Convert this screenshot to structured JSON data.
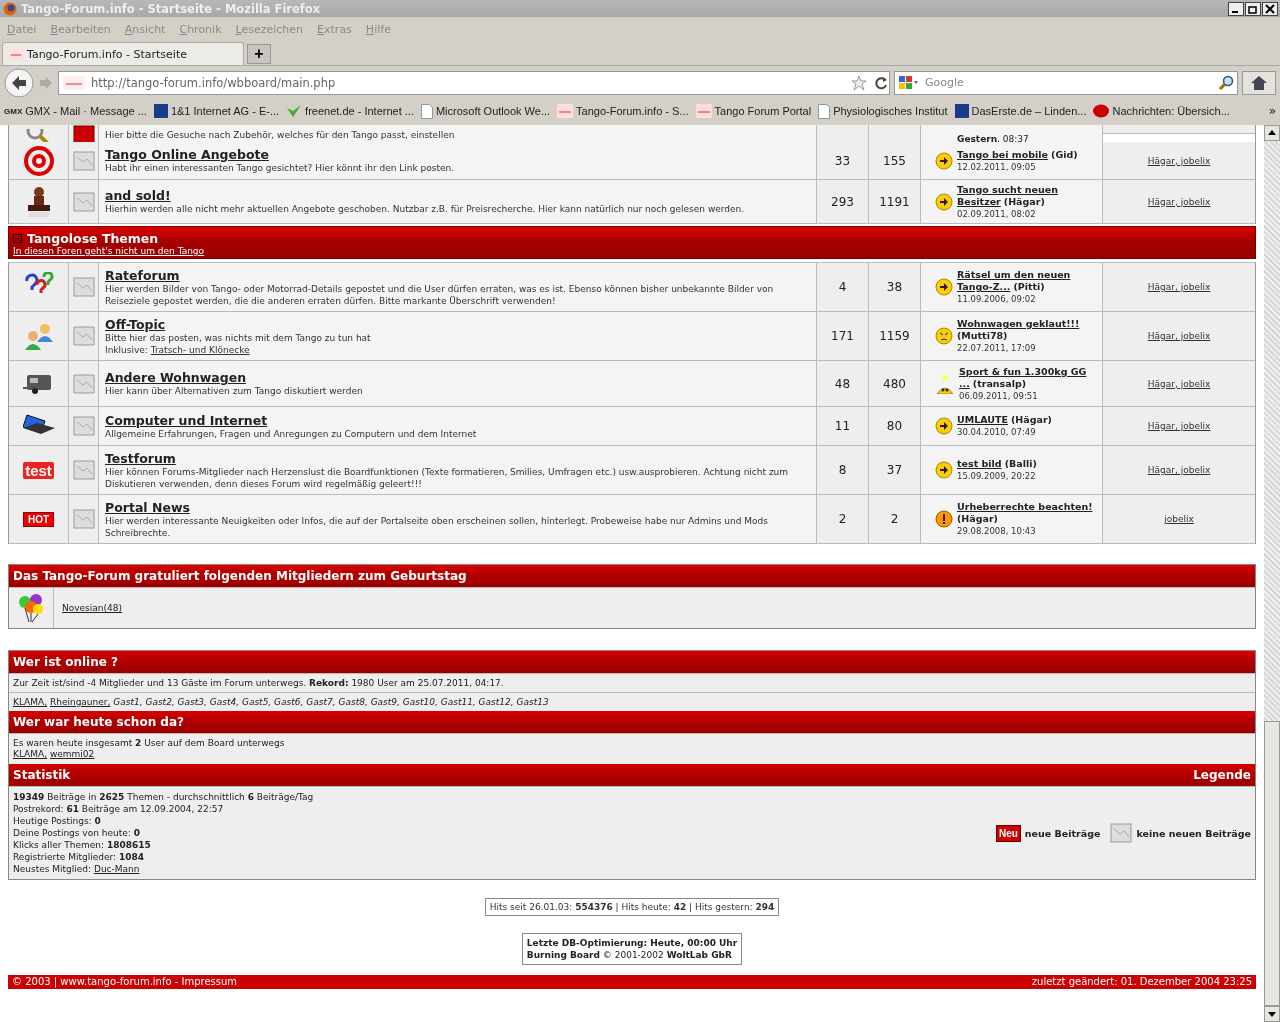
{
  "window": {
    "title": "Tango-Forum.info - Startseite - Mozilla Firefox"
  },
  "menu": [
    "Datei",
    "Bearbeiten",
    "Ansicht",
    "Chronik",
    "Lesezeichen",
    "Extras",
    "Hilfe"
  ],
  "tab": {
    "title": "Tango-Forum.info - Startseite",
    "new_tab": "+"
  },
  "address": {
    "url": "http://tango-forum.info/wbboard/main.php",
    "search_placeholder": "Google"
  },
  "bookmarks": [
    {
      "label": "GMX - Mail · Message ...",
      "kind": "gmx",
      "badge": "GMX"
    },
    {
      "label": "1&1 Internet AG - E-...",
      "kind": "square"
    },
    {
      "label": "freenet.de - Internet ...",
      "kind": "check"
    },
    {
      "label": "Microsoft Outlook We...",
      "kind": "page"
    },
    {
      "label": "Tango-Forum.info - S...",
      "kind": "tango"
    },
    {
      "label": "Tango Forum Portal",
      "kind": "tango"
    },
    {
      "label": "Physiologisches Institut",
      "kind": "page"
    },
    {
      "label": "DasErste.de – Linden...",
      "kind": "square"
    },
    {
      "label": "Nachrichten: Übersich...",
      "kind": "dot"
    }
  ],
  "bookmarks_more": "»",
  "cut_row": {
    "new": true,
    "description": "Hier bitte die Gesuche nach Zubehör, welches für den Tango passt, einstellen",
    "last_date": "**Gestern**, 08:37"
  },
  "forums_top": [
    {
      "kind": "at",
      "new": false,
      "title": "Tango Online Angebote",
      "description": "Habt ihr einen interessanten Tango gesichtet? Hier könnt ihr den Link posten.",
      "threads": "33",
      "posts": "155",
      "last_post": {
        "kind": "arrow",
        "title": "Tango bei mobile",
        "author": "(Gid)",
        "date": "12.02.2011, 09:05"
      },
      "moderators": "Hägar, jobelix"
    },
    {
      "kind": "sold",
      "new": false,
      "title": "and sold!",
      "description": "Hierhin werden alle nicht mehr aktuellen Angebote geschoben. Nutzbar z.B. für Preisrecherche. Hier kann natürlich nur noch gelesen werden.",
      "threads": "293",
      "posts": "1191",
      "last_post": {
        "kind": "arrow",
        "title": "Tango sucht neuen Besitzer",
        "author": "(Hägar)",
        "date": "02.09.2011, 08:02"
      },
      "moderators": "Hägar, jobelix"
    }
  ],
  "category": {
    "title": "Tangolose Themen",
    "subtitle": "In diesen Foren geht's nicht um den Tango",
    "expanded": true
  },
  "forums": [
    {
      "kind": "question",
      "new": false,
      "title": "Rateforum",
      "description": "Hier werden Bilder von Tango- oder Motorrad-Details gepostet und die User dürfen erraten, was es ist. Ebenso können bisher unbekannte Bilder von Reiseziele gepostet werden, die die anderen erraten dürfen. Bitte markante Überschrift verwenden!",
      "threads": "4",
      "posts": "38",
      "last_post": {
        "kind": "arrow",
        "title": "Rätsel um den neuen Tango-Z...",
        "author": "(Pitti)",
        "date": "11.09.2006, 09:02"
      },
      "moderators": "Hägar, jobelix"
    },
    {
      "kind": "people",
      "new": false,
      "title": "Off-Topic",
      "description": "Bitte hier das posten, was nichts mit dem Tango zu tun hat",
      "sub_prefix": "Inklusive:",
      "sub_link": "Tratsch- und Klönecke",
      "threads": "171",
      "posts": "1159",
      "last_post": {
        "kind": "angry",
        "title": "Wohnwagen geklaut!!!",
        "author": "(Mutti78)",
        "date": "22.07.2011, 17:09"
      },
      "moderators": "Hägar, jobelix"
    },
    {
      "kind": "caravan",
      "new": false,
      "title": "Andere Wohnwagen",
      "description": "Hier kann über Alternativen zum Tango diskutiert werden",
      "threads": "48",
      "posts": "480",
      "last_post": {
        "kind": "idea",
        "title": "Sport & fun 1.300kg GG ...",
        "author": "(transalp)",
        "date": "06.09.2011, 09:51"
      },
      "moderators": "Hägar, jobelix"
    },
    {
      "kind": "laptop",
      "new": false,
      "title": "Computer und Internet",
      "description": "Allgemeine Erfahrungen, Fragen und Anregungen zu Computern und dem Internet",
      "threads": "11",
      "posts": "80",
      "last_post": {
        "kind": "arrow",
        "title": "UMLAUTE",
        "author": "(Hägar)",
        "date": "30.04.2010, 07:49"
      },
      "moderators": "Hägar, jobelix"
    },
    {
      "kind": "test",
      "badge": "test",
      "new": false,
      "title": "Testforum",
      "description": "Hier können Forums-Mitglieder nach Herzenslust die Boardfunktionen (Texte formatieren, Smilies, Umfragen etc.) usw.ausprobieren. Achtung nicht zum Diskutieren verwenden, denn dieses Forum wird regelmäßig geleert!!!",
      "threads": "8",
      "posts": "37",
      "last_post": {
        "kind": "arrow",
        "title": "test bild",
        "author": "(Balli)",
        "date": "15.09.2009, 20:22"
      },
      "moderators": "Hägar, jobelix"
    },
    {
      "kind": "hot",
      "badge": "HOT",
      "new": false,
      "title": "Portal News",
      "description": "Hier werden interessante Neuigkeiten oder Infos, die auf der Portalseite oben erscheinen sollen, hinterlegt. Probeweise habe nur Admins und Mods Schreibrechte.",
      "threads": "2",
      "posts": "2",
      "last_post": {
        "kind": "warning",
        "title": "Urheberrechte beachten!",
        "author": "(Hägar)",
        "date": "29.08.2008, 10:43"
      },
      "moderators": "jobelix"
    }
  ],
  "birthday": {
    "title": "Das Tango-Forum gratuliert folgenden Mitgliedern zum Geburtstag",
    "members": [
      "Novesian(48)"
    ]
  },
  "online": {
    "title": "Wer ist online ?",
    "text": "Zur Zeit ist/sind -4 Mitglieder und 13 Gäste im Forum unterwegs. **Rekord:** 1980 User am 25.07.2011, 04:17.",
    "users": [
      {
        "name": "KLAMA,",
        "kind": "member"
      },
      {
        "name": "Rheingauner,",
        "kind": "member"
      },
      {
        "name": "Gast1,",
        "kind": "guest"
      },
      {
        "name": "Gast2,",
        "kind": "guest"
      },
      {
        "name": "Gast3,",
        "kind": "guest"
      },
      {
        "name": "Gast4,",
        "kind": "guest"
      },
      {
        "name": "Gast5,",
        "kind": "guest"
      },
      {
        "name": "Gast6,",
        "kind": "guest"
      },
      {
        "name": "Gast7,",
        "kind": "guest"
      },
      {
        "name": "Gast8,",
        "kind": "guest"
      },
      {
        "name": "Gast9,",
        "kind": "guest"
      },
      {
        "name": "Gast10,",
        "kind": "guest"
      },
      {
        "name": "Gast11,",
        "kind": "guest"
      },
      {
        "name": "Gast12,",
        "kind": "guest"
      },
      {
        "name": "Gast13",
        "kind": "guest"
      }
    ]
  },
  "today": {
    "title": "Wer war heute schon da?",
    "text": "Es waren heute insgesamt **2** User auf dem Board unterwegs",
    "users": [
      "KLAMA,",
      "wemmi02"
    ]
  },
  "stats": {
    "title": "Statistik",
    "legend_title": "Legende",
    "lines": [
      "**19349** Beiträge in **2625** Themen - durchschnittlich **6** Beiträge/Tag",
      "Postrekord: **61** Beiträge am 12.09.2004, 22:57",
      "Heutige Postings: **0**",
      "Deine Postings von heute: **0**",
      "Klicks aller Themen: **1808615**",
      "Registrierte Mitglieder: **1084**"
    ],
    "newest_label": "Neustes Mitglied:",
    "newest_member": "Duc-Mann",
    "legend": [
      {
        "kind": "new",
        "badge": "Neu",
        "label": "neue Beiträge"
      },
      {
        "kind": "old",
        "label": "keine neuen Beiträge"
      }
    ]
  },
  "hits": "Hits seit 26.01.03: **554376** | Hits heute: **42** | Hits gestern: **294**",
  "db": [
    "**Letzte DB-Optimierung: Heute, 00:00 Uhr**",
    "**Burning Board** © 2001-2002 **WoltLab GbR**"
  ],
  "footer": {
    "left": "© 2003 | www.tango-forum.info - Impressum",
    "right": "zuletzt geändert: 01. Dezember 2004 23:25"
  }
}
